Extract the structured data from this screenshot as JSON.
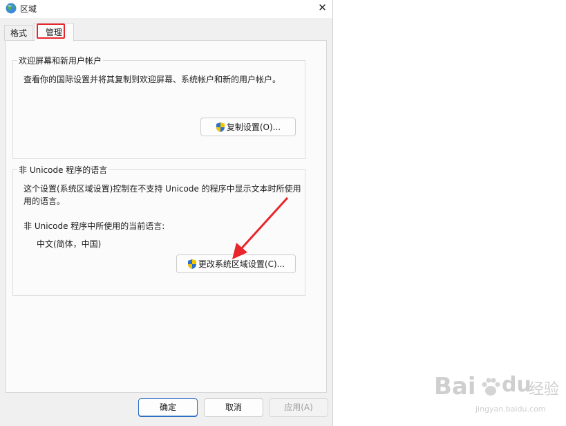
{
  "window": {
    "title": "区域",
    "close_glyph": "✕"
  },
  "tabs": [
    {
      "label": "格式"
    },
    {
      "label": "管理"
    }
  ],
  "welcome_group": {
    "legend": "欢迎屏幕和新用户帐户",
    "description": "查看你的国际设置并将其复制到欢迎屏幕、系统帐户和新的用户帐户。",
    "button_label": "复制设置(O)..."
  },
  "unicode_group": {
    "legend": "非 Unicode 程序的语言",
    "description_line1": "这个设置(系统区域设置)控制在不支持 Unicode 的程序中显示文本时所使用",
    "description_line2": "用的语言。",
    "current_label": "非 Unicode 程序中所使用的当前语言:",
    "current_value": "中文(简体，中国)",
    "button_label": "更改系统区域设置(C)..."
  },
  "footer": {
    "ok_label": "确定",
    "cancel_label": "取消",
    "apply_label": "应用(A)"
  },
  "watermark": {
    "brand": "Bai",
    "brand2": "du",
    "cn": "经验",
    "url": "jingyan.baidu.com"
  },
  "colors": {
    "highlight": "#e8262b",
    "arrow": "#e8262b",
    "primary_border": "#2f6ec4"
  },
  "icons": {
    "app": "globe-icon",
    "shield": "uac-shield-icon",
    "close": "close-icon"
  }
}
